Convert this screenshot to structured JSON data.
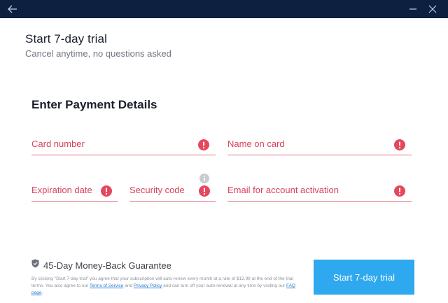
{
  "header": {
    "title": "Start 7-day trial",
    "subtitle": "Cancel anytime, no questions asked"
  },
  "payment": {
    "section_title": "Enter Payment Details",
    "fields": {
      "card_number": "Card number",
      "name_on_card": "Name on card",
      "expiration_date": "Expiration date",
      "security_code": "Security code",
      "email": "Email for account activation"
    }
  },
  "footer": {
    "guarantee": "45-Day Money-Back Guarantee",
    "legal": {
      "part1": "By clicking \"Start 7-day trial\" you agree that your subscription will auto-renew every month at a rate of $12.99 at the end of the trial terms. You also agree to our ",
      "terms_link": "Terms of Service",
      "part2": " and ",
      "privacy_link": "Privacy Policy",
      "part3": " and can turn off your auto-renewal at any time by visiting our ",
      "faq_link": "FAQ page",
      "part4": "."
    },
    "cta_label": "Start 7-day trial"
  },
  "icons": {
    "back": "back-arrow-icon",
    "minimize": "minimize-icon",
    "close": "close-icon",
    "error": "error-icon",
    "info": "info-icon",
    "shield": "shield-icon"
  },
  "colors": {
    "titlebar": "#0e2040",
    "error": "#e5485e",
    "accent": "#2ea8ee"
  }
}
